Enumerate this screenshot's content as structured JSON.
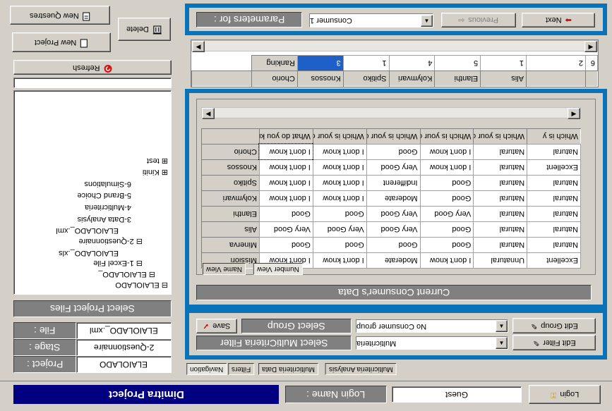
{
  "app": {
    "user_title": "Dimitra Project",
    "login_label": "Login Name :",
    "login_value": "Guest",
    "login_button": "Login"
  },
  "left_panel": {
    "new_questires": "New Questres",
    "new_project": "New Project",
    "delete": "Delete",
    "refresh": "Refresh",
    "select_project_files": "Select Project Files",
    "file_label": "File :",
    "file_value": "ELAIOLADO_.xml",
    "stage_label": "Stage :",
    "stage_value": "2-Questionnaire",
    "project_label": "Project :",
    "project_value": "ELAIOLADO",
    "tree": [
      "ELAIOLADO",
      "ELAIOLADO_",
      "1-Excel File",
      "ELAIOLADO_.xls",
      "2-Questionnaire",
      "ELAIOLADO_.xml",
      "3-Data Analysis",
      "4-Multicriteria",
      "5-Brand Choice",
      "6-Simulations",
      "Kiniti",
      "test"
    ]
  },
  "params": {
    "label": "Parameters for :",
    "consumer": "Consumer 1",
    "previous": "Previous",
    "next": "Next"
  },
  "ranking": {
    "label": "Ranking",
    "brands": [
      "Chorio",
      "Knossos",
      "Spitiko",
      "Kolymvari",
      "Elanthi",
      "Alis"
    ],
    "ranks": [
      "3",
      "1",
      "4",
      "5",
      "1",
      "2"
    ],
    "extra_rank": "6"
  },
  "consumer_data": {
    "title": "Current Consumer's Data",
    "tab_number_view": "Number View",
    "tab_name_view": "Name View",
    "questions": [
      "What do you kn",
      "Which is your op",
      "Which is your op",
      "Which is your op",
      "Which is your op",
      "Which is y"
    ],
    "rows": [
      {
        "brand": "Chorio",
        "cells": [
          "I don't know",
          "I don't know",
          "Good",
          "I don't know",
          "Natural",
          "Natural"
        ]
      },
      {
        "brand": "Knossos",
        "cells": [
          "I don't know",
          "I don't know",
          "Very Good",
          "I don't know",
          "Natural",
          "Excellent"
        ]
      },
      {
        "brand": "Spitiko",
        "cells": [
          "I don't know",
          "I don't know",
          "Indifferent",
          "Good",
          "Natural",
          "Natural"
        ]
      },
      {
        "brand": "Kolymvari",
        "cells": [
          "I don't know",
          "I don't know",
          "Moderate",
          "Good",
          "Natural",
          "Natural"
        ]
      },
      {
        "brand": "Elanthi",
        "cells": [
          "Good",
          "Good",
          "Very Good",
          "Very Good",
          "Natural",
          "Natural"
        ]
      },
      {
        "brand": "Alis",
        "cells": [
          "Very Good",
          "Very Good",
          "Very Good",
          "Good",
          "Natural",
          "Natural"
        ]
      },
      {
        "brand": "Minerva",
        "cells": [
          "Good",
          "Good",
          "Good",
          "Good",
          "Natural",
          "Natural"
        ]
      },
      {
        "brand": "Missiori",
        "cells": [
          "I don't know",
          "I don't know",
          "Moderate",
          "I don't know",
          "Unnatural",
          "Excellent"
        ]
      }
    ]
  },
  "filters": {
    "save": "Save",
    "select_group": "Select Group",
    "group_value": "No Consumer group",
    "edit_group": "Edit Group",
    "select_mc_filter": "Select MultiCriteria Filter",
    "mc_value": "Multicriteria",
    "edit_filter": "Edit Filter"
  },
  "bottom_tabs": [
    "Navigation",
    "Filters",
    "Multicriteria Data",
    "Multicriteria Analysis"
  ],
  "colors": {
    "frame_blue": "#0a72b6",
    "title_navy": "#000080",
    "selected_cell": "#1f5fc8"
  }
}
